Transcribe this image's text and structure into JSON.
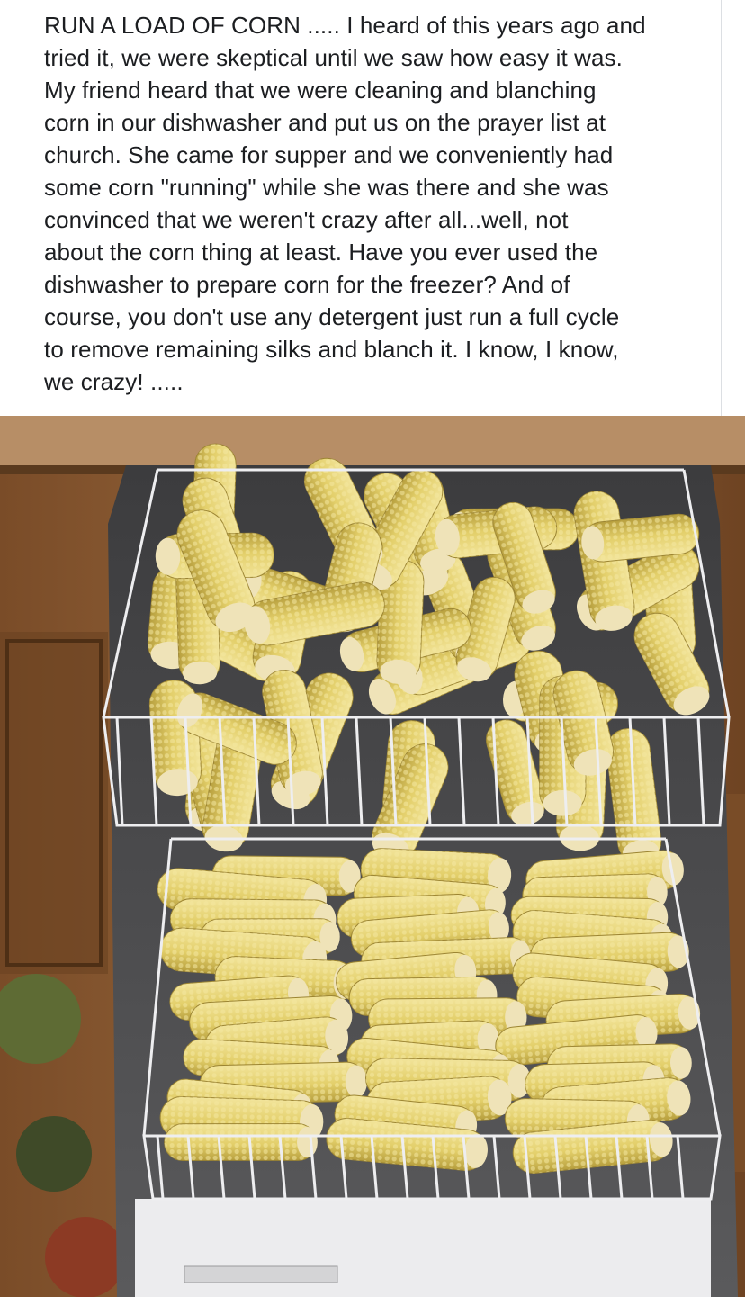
{
  "post": {
    "text": "RUN A LOAD OF CORN ..... I heard of this years ago and\ntried it, we were skeptical until we saw how easy it was.\nMy friend heard that we were cleaning and blanching\ncorn in our dishwasher and put us on the prayer list at\nchurch. She came for supper and we conveniently had\nsome corn \"running\" while she was there and she was\nconvinced that we weren't crazy after all...well, not\nabout the corn thing at least. Have you ever used the\ndishwasher to prepare corn for the freezer? And of\ncourse, you don't use any detergent just run a full cycle\nto remove remaining silks and blanch it. I know, I know,\nwe crazy! .....",
    "photo": {
      "description_icon": "photo-dishwasher-corn",
      "colors": {
        "cabinet": "#8a5a32",
        "cabinet_dark": "#5e3a1e",
        "corn": "#e9d77a",
        "corn_shade": "#c8b24d",
        "rack": "#e8e8ea",
        "tub": "#4a4a4c"
      }
    }
  }
}
